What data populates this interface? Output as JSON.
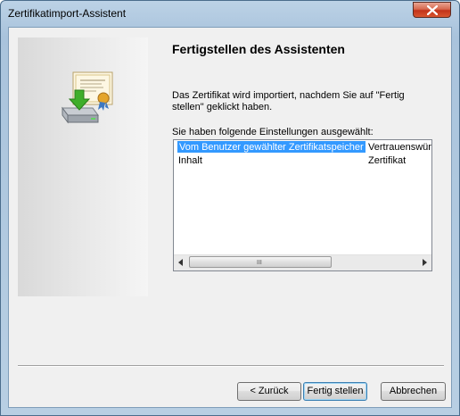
{
  "window": {
    "title": "Zertifikatimport-Assistent"
  },
  "content": {
    "title": "Fertigstellen des Assistenten",
    "intro": "Das Zertifikat wird importiert, nachdem Sie auf \"Fertig stellen\" geklickt haben.",
    "settings_label": "Sie haben folgende Einstellungen ausgewählt:"
  },
  "settings_list": {
    "rows": [
      {
        "key": "Vom Benutzer gewählter Zertifikatspeicher",
        "value": "Vertrauenswür",
        "selected": true
      },
      {
        "key": "Inhalt",
        "value": "Zertifikat",
        "selected": false
      }
    ],
    "scroll_grip": "III"
  },
  "buttons": {
    "back": "< Zurück",
    "finish": "Fertig stellen",
    "cancel": "Abbrechen"
  },
  "icons": {
    "close": "close-icon",
    "wizard": "certificate-import-icon"
  },
  "colors": {
    "selection": "#3399ff",
    "close_button": "#c2331a"
  }
}
